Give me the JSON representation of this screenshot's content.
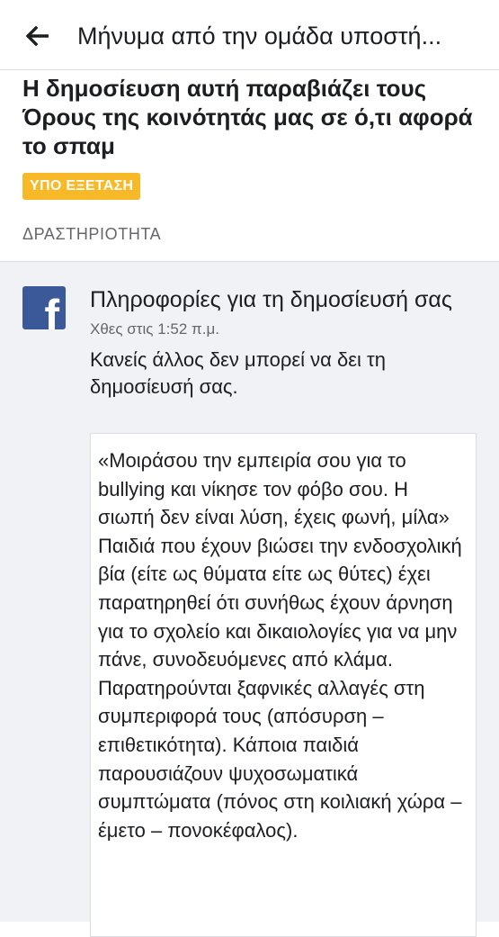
{
  "header": {
    "title": "Μήνυμα από την ομάδα υποστή...",
    "back_icon": "arrow-left-icon"
  },
  "notice": {
    "headline": "Η δημοσίευση αυτή παραβιάζει τους Όρους της κοινότητάς μας σε ό,τι αφορά το σπαμ",
    "status_badge": "ΥΠΟ ΕΞΕΤΑΣΗ",
    "badge_color": "#f7b928"
  },
  "activity": {
    "section_label": "ΔΡΑΣΤΗΡΙΟΤΗΤΑ",
    "logo_icon": "facebook-logo-icon",
    "item_title": "Πληροφορίες για τη δημοσίευσή σας",
    "timestamp": "Χθες στις 1:52 π.μ.",
    "description": "Κανείς άλλος δεν μπορεί να δει τη δημοσίευσή σας.",
    "post_text": "«Μοιράσου την εμπειρία σου για το bullying και νίκησε τον φόβο σου. Η σιωπή δεν είναι λύση, έχεις φωνή, μίλα» Παιδιά που έχουν βιώσει την ενδοσχολική βία (είτε ως θύματα είτε ως θύτες) έχει παρατηρηθεί ότι συνήθως έχουν άρνηση για το σχολείο και δικαιολογίες για να μην πάνε, συνοδευόμενες από κλάμα. Παρατηρούνται ξαφνικές αλλαγές στη συμπεριφορά τους (απόσυρση – επιθετικότητα). Κάποια παιδιά παρουσιάζουν ψυχοσωματικά συμπτώματα (πόνος στη κοιλιακή χώρα – έμετο – πονοκέφαλος)."
  },
  "colors": {
    "facebook_blue": "#3b5998",
    "background_gray": "#f0f2f5"
  }
}
